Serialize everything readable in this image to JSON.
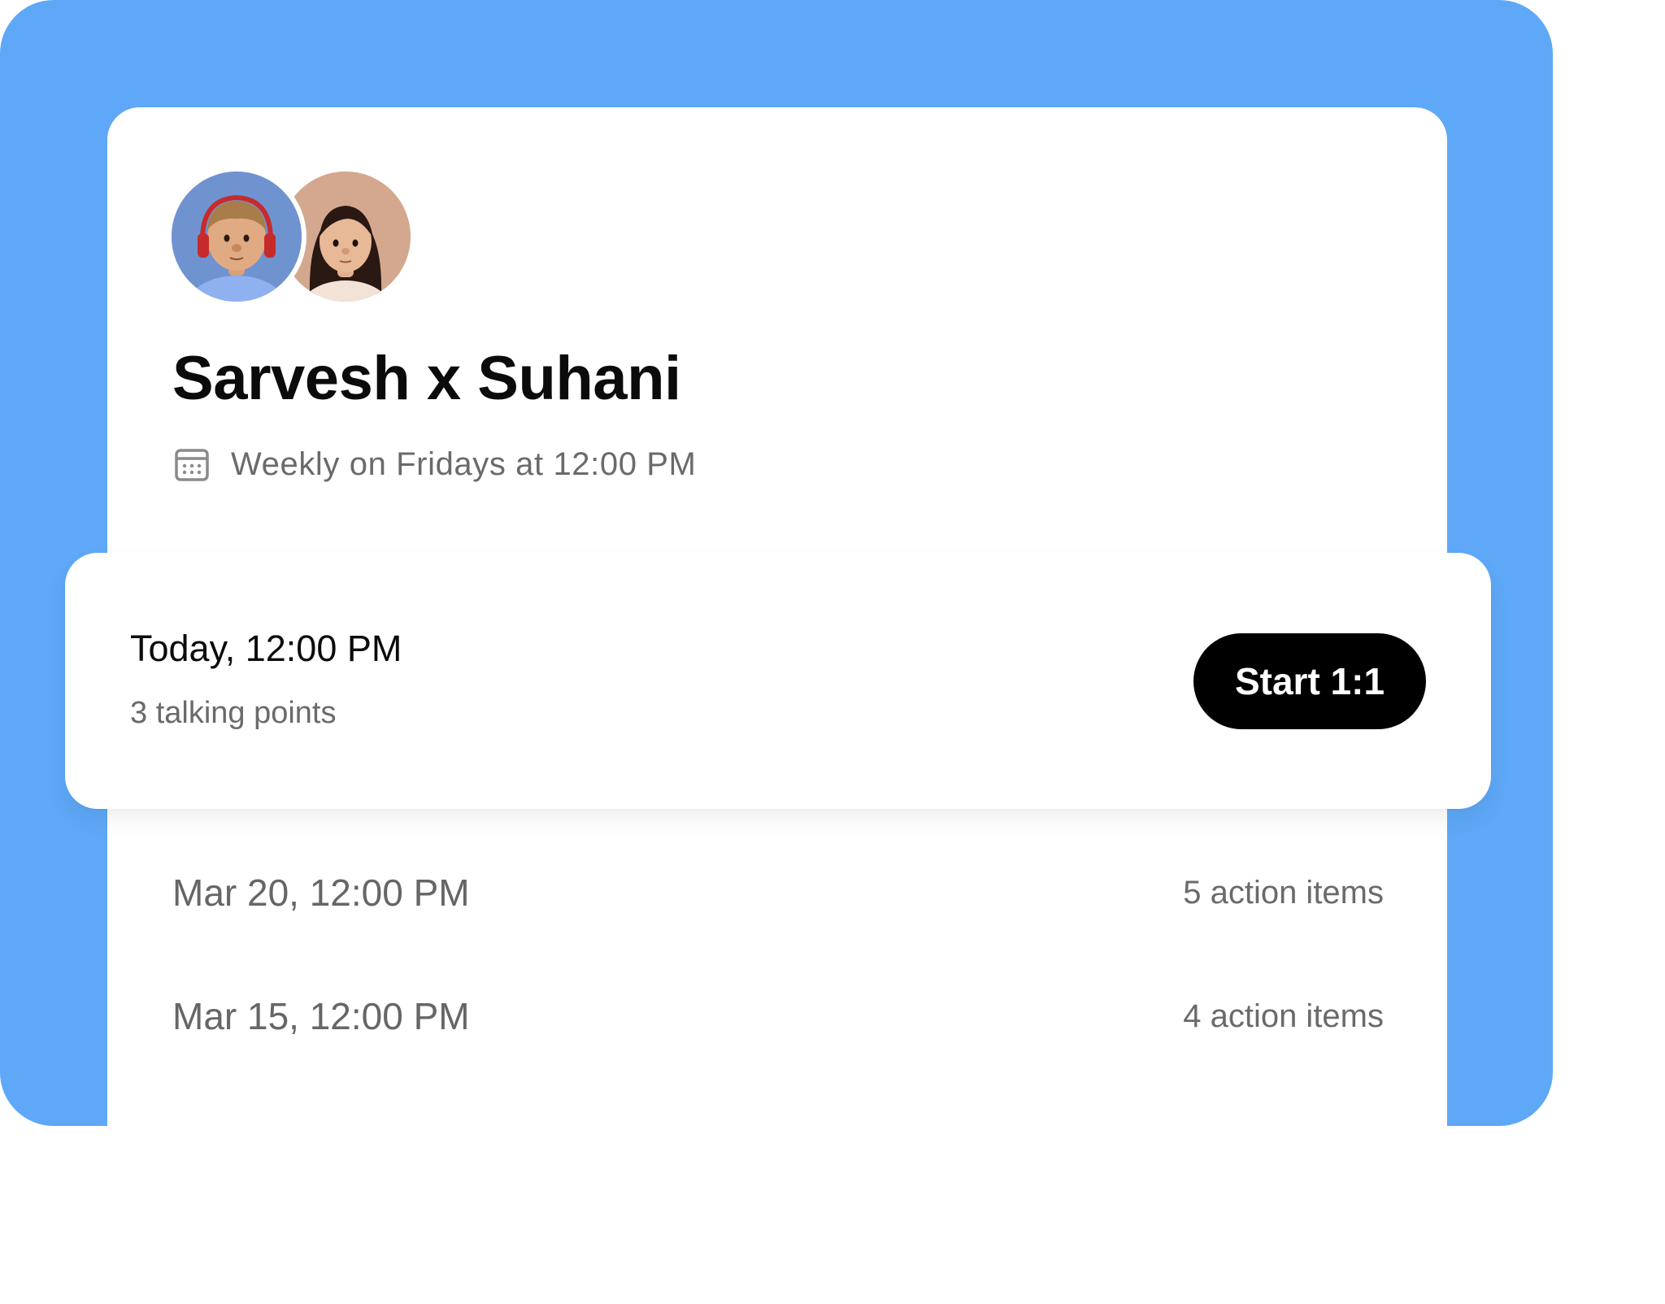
{
  "meeting": {
    "title": "Sarvesh x Suhani",
    "schedule": "Weekly on Fridays at 12:00 PM",
    "participants": [
      {
        "name": "Sarvesh",
        "avatar_icon": "avatar-man-headphones-icon"
      },
      {
        "name": "Suhani",
        "avatar_icon": "avatar-woman-icon"
      }
    ]
  },
  "upcoming": {
    "time": "Today, 12:00 PM",
    "subtitle": "3 talking points",
    "start_label": "Start 1:1"
  },
  "history": [
    {
      "date": "Mar 20, 12:00 PM",
      "meta": "5 action items"
    },
    {
      "date": "Mar 15, 12:00 PM",
      "meta": "4 action items"
    }
  ],
  "colors": {
    "background_accent": "#5ea8f7",
    "button": "#000000"
  }
}
